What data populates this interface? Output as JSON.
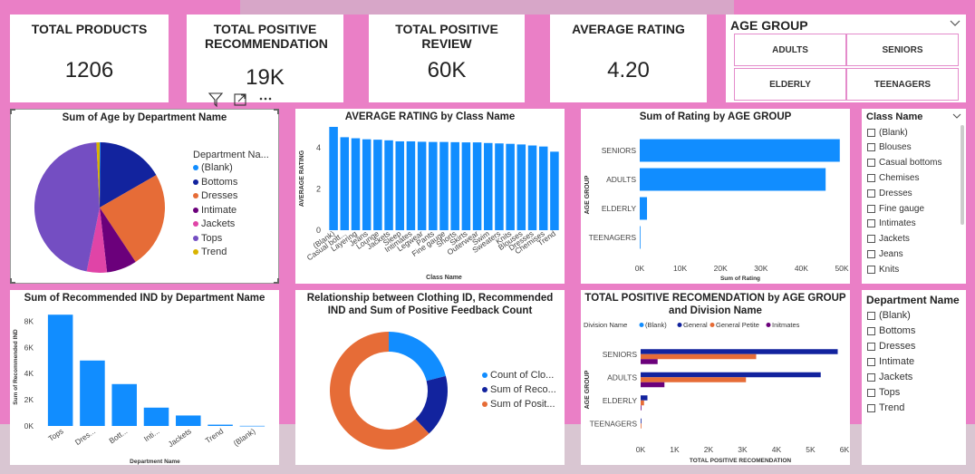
{
  "kpis": [
    {
      "title": "TOTAL PRODUCTS",
      "value": "1206"
    },
    {
      "title": "TOTAL POSITIVE RECOMMENDATION",
      "value": "19K"
    },
    {
      "title": "TOTAL POSITIVE REVIEW",
      "value": "60K"
    },
    {
      "title": "AVERAGE RATING",
      "value": "4.20"
    }
  ],
  "age_slicer": {
    "title": "AGE GROUP",
    "options": [
      "ADULTS",
      "SENIORS",
      "ELDERLY",
      "TEENAGERS"
    ]
  },
  "class_slicer": {
    "title": "Class Name",
    "items": [
      "(Blank)",
      "Blouses",
      "Casual bottoms",
      "Chemises",
      "Dresses",
      "Fine gauge",
      "Intimates",
      "Jackets",
      "Jeans",
      "Knits"
    ]
  },
  "dept_slicer": {
    "title": "Department Name",
    "items": [
      "(Blank)",
      "Bottoms",
      "Dresses",
      "Intimate",
      "Jackets",
      "Tops",
      "Trend"
    ]
  },
  "toolbar": {
    "filter": "filter-icon",
    "focus": "focus-mode-icon",
    "more": "more-options-icon"
  },
  "colors": {
    "blue": "#118dff",
    "navy": "#12239e",
    "orange": "#e66c37",
    "purple": "#6b007b",
    "pink": "#e044a7",
    "violet": "#744ec2",
    "gold": "#d9b300"
  },
  "chart_data": [
    {
      "type": "pie",
      "title": "Sum of Age by Department Name",
      "legend_title": "Department Na...",
      "legend_position": "right",
      "categories": [
        "(Blank)",
        "Bottoms",
        "Dresses",
        "Intimate",
        "Jackets",
        "Tops",
        "Trend"
      ],
      "values": [
        0.2,
        16.5,
        24,
        7.5,
        5,
        46,
        0.8
      ],
      "colors": [
        "#118dff",
        "#12239e",
        "#e66c37",
        "#6b007b",
        "#e044a7",
        "#744ec2",
        "#d9b300"
      ]
    },
    {
      "type": "bar",
      "title": "AVERAGE RATING by Class Name",
      "xlabel": "Class Name",
      "ylabel": "AVERAGE RATING",
      "ylim": [
        0,
        5
      ],
      "yticks": [
        0,
        2,
        4
      ],
      "categories": [
        "(Blank)",
        "Casual bott...",
        "Layering",
        "Jeans",
        "Lounge",
        "Jackets",
        "Sleep",
        "Intimates",
        "Legwear",
        "Pants",
        "Fine gauge",
        "Shorts",
        "Skirts",
        "Outerwear",
        "Swim",
        "Sweaters",
        "Knits",
        "Blouses",
        "Dresses",
        "Chemises",
        "Trend"
      ],
      "values": [
        5.0,
        4.5,
        4.45,
        4.4,
        4.38,
        4.35,
        4.3,
        4.3,
        4.28,
        4.27,
        4.27,
        4.26,
        4.25,
        4.25,
        4.22,
        4.2,
        4.18,
        4.15,
        4.1,
        4.05,
        3.8
      ]
    },
    {
      "type": "bar",
      "orientation": "horizontal",
      "title": "Sum of Rating by AGE GROUP",
      "xlabel": "Sum of Rating",
      "ylabel": "AGE GROUP",
      "xlim": [
        0,
        50000
      ],
      "xticks": [
        "0K",
        "10K",
        "20K",
        "30K",
        "40K",
        "50K"
      ],
      "categories": [
        "SENIORS",
        "ADULTS",
        "ELDERLY",
        "TEENAGERS"
      ],
      "values": [
        49500,
        46000,
        1800,
        100
      ]
    },
    {
      "type": "bar",
      "title": "Sum of Recommended IND by Department Name",
      "xlabel": "Department Name",
      "ylabel": "Sum of Recommended IND",
      "ylim": [
        0,
        9000
      ],
      "yticks": [
        "0K",
        "2K",
        "4K",
        "6K",
        "8K"
      ],
      "categories": [
        "Tops",
        "Dres...",
        "Bott...",
        "Inti...",
        "Jackets",
        "Trend",
        "(Blank)"
      ],
      "values": [
        8500,
        5000,
        3200,
        1400,
        800,
        100,
        10
      ]
    },
    {
      "type": "pie",
      "subtype": "donut",
      "title": "Relationship between Clothing ID, Recommended IND and Sum of Positive Feedback Count",
      "legend_position": "right",
      "categories": [
        "Count of Clo...",
        "Sum of Reco...",
        "Sum of Posit..."
      ],
      "values": [
        21,
        17,
        62
      ],
      "colors": [
        "#118dff",
        "#12239e",
        "#e66c37"
      ]
    },
    {
      "type": "bar",
      "orientation": "horizontal",
      "title": "TOTAL POSITIVE RECOMENDATION by AGE GROUP and Division Name",
      "legend_title": "Division Name",
      "legend_position": "top-left",
      "xlabel": "TOTAL POSITIVE RECOMENDATION",
      "ylabel": "AGE GROUP",
      "xlim": [
        0,
        6000
      ],
      "xticks": [
        "0K",
        "1K",
        "2K",
        "3K",
        "4K",
        "5K",
        "6K"
      ],
      "categories": [
        "SENIORS",
        "ADULTS",
        "ELDERLY",
        "TEENAGERS"
      ],
      "series": [
        {
          "name": "(Blank)",
          "color": "#118dff",
          "values": [
            0,
            0,
            0,
            0
          ]
        },
        {
          "name": "General",
          "color": "#12239e",
          "values": [
            5800,
            5300,
            200,
            10
          ]
        },
        {
          "name": "General Petite",
          "color": "#e66c37",
          "values": [
            3400,
            3100,
            100,
            5
          ]
        },
        {
          "name": "Initmates",
          "color": "#6b007b",
          "values": [
            500,
            700,
            20,
            0
          ]
        }
      ]
    }
  ]
}
